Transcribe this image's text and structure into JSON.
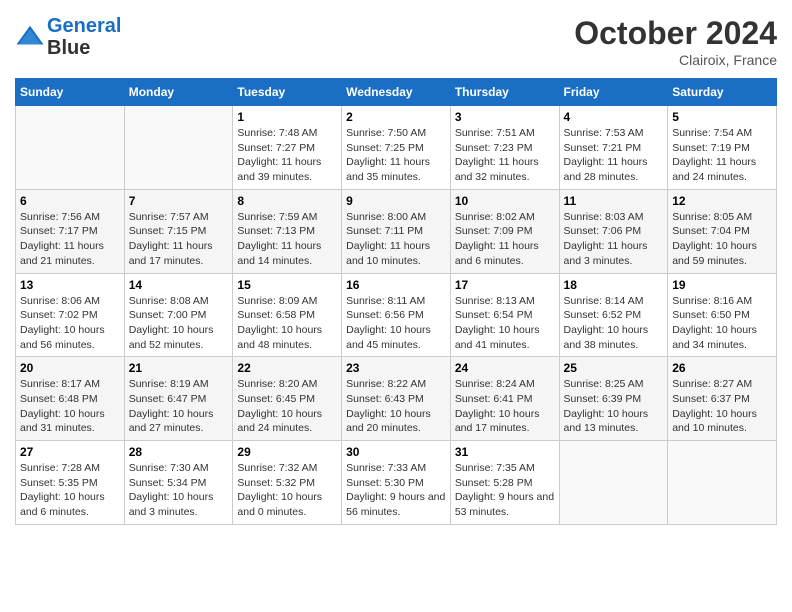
{
  "header": {
    "logo_line1": "General",
    "logo_line2": "Blue",
    "month": "October 2024",
    "location": "Clairoix, France"
  },
  "days_of_week": [
    "Sunday",
    "Monday",
    "Tuesday",
    "Wednesday",
    "Thursday",
    "Friday",
    "Saturday"
  ],
  "weeks": [
    [
      {
        "day": "",
        "info": ""
      },
      {
        "day": "",
        "info": ""
      },
      {
        "day": "1",
        "info": "Sunrise: 7:48 AM\nSunset: 7:27 PM\nDaylight: 11 hours and 39 minutes."
      },
      {
        "day": "2",
        "info": "Sunrise: 7:50 AM\nSunset: 7:25 PM\nDaylight: 11 hours and 35 minutes."
      },
      {
        "day": "3",
        "info": "Sunrise: 7:51 AM\nSunset: 7:23 PM\nDaylight: 11 hours and 32 minutes."
      },
      {
        "day": "4",
        "info": "Sunrise: 7:53 AM\nSunset: 7:21 PM\nDaylight: 11 hours and 28 minutes."
      },
      {
        "day": "5",
        "info": "Sunrise: 7:54 AM\nSunset: 7:19 PM\nDaylight: 11 hours and 24 minutes."
      }
    ],
    [
      {
        "day": "6",
        "info": "Sunrise: 7:56 AM\nSunset: 7:17 PM\nDaylight: 11 hours and 21 minutes."
      },
      {
        "day": "7",
        "info": "Sunrise: 7:57 AM\nSunset: 7:15 PM\nDaylight: 11 hours and 17 minutes."
      },
      {
        "day": "8",
        "info": "Sunrise: 7:59 AM\nSunset: 7:13 PM\nDaylight: 11 hours and 14 minutes."
      },
      {
        "day": "9",
        "info": "Sunrise: 8:00 AM\nSunset: 7:11 PM\nDaylight: 11 hours and 10 minutes."
      },
      {
        "day": "10",
        "info": "Sunrise: 8:02 AM\nSunset: 7:09 PM\nDaylight: 11 hours and 6 minutes."
      },
      {
        "day": "11",
        "info": "Sunrise: 8:03 AM\nSunset: 7:06 PM\nDaylight: 11 hours and 3 minutes."
      },
      {
        "day": "12",
        "info": "Sunrise: 8:05 AM\nSunset: 7:04 PM\nDaylight: 10 hours and 59 minutes."
      }
    ],
    [
      {
        "day": "13",
        "info": "Sunrise: 8:06 AM\nSunset: 7:02 PM\nDaylight: 10 hours and 56 minutes."
      },
      {
        "day": "14",
        "info": "Sunrise: 8:08 AM\nSunset: 7:00 PM\nDaylight: 10 hours and 52 minutes."
      },
      {
        "day": "15",
        "info": "Sunrise: 8:09 AM\nSunset: 6:58 PM\nDaylight: 10 hours and 48 minutes."
      },
      {
        "day": "16",
        "info": "Sunrise: 8:11 AM\nSunset: 6:56 PM\nDaylight: 10 hours and 45 minutes."
      },
      {
        "day": "17",
        "info": "Sunrise: 8:13 AM\nSunset: 6:54 PM\nDaylight: 10 hours and 41 minutes."
      },
      {
        "day": "18",
        "info": "Sunrise: 8:14 AM\nSunset: 6:52 PM\nDaylight: 10 hours and 38 minutes."
      },
      {
        "day": "19",
        "info": "Sunrise: 8:16 AM\nSunset: 6:50 PM\nDaylight: 10 hours and 34 minutes."
      }
    ],
    [
      {
        "day": "20",
        "info": "Sunrise: 8:17 AM\nSunset: 6:48 PM\nDaylight: 10 hours and 31 minutes."
      },
      {
        "day": "21",
        "info": "Sunrise: 8:19 AM\nSunset: 6:47 PM\nDaylight: 10 hours and 27 minutes."
      },
      {
        "day": "22",
        "info": "Sunrise: 8:20 AM\nSunset: 6:45 PM\nDaylight: 10 hours and 24 minutes."
      },
      {
        "day": "23",
        "info": "Sunrise: 8:22 AM\nSunset: 6:43 PM\nDaylight: 10 hours and 20 minutes."
      },
      {
        "day": "24",
        "info": "Sunrise: 8:24 AM\nSunset: 6:41 PM\nDaylight: 10 hours and 17 minutes."
      },
      {
        "day": "25",
        "info": "Sunrise: 8:25 AM\nSunset: 6:39 PM\nDaylight: 10 hours and 13 minutes."
      },
      {
        "day": "26",
        "info": "Sunrise: 8:27 AM\nSunset: 6:37 PM\nDaylight: 10 hours and 10 minutes."
      }
    ],
    [
      {
        "day": "27",
        "info": "Sunrise: 7:28 AM\nSunset: 5:35 PM\nDaylight: 10 hours and 6 minutes."
      },
      {
        "day": "28",
        "info": "Sunrise: 7:30 AM\nSunset: 5:34 PM\nDaylight: 10 hours and 3 minutes."
      },
      {
        "day": "29",
        "info": "Sunrise: 7:32 AM\nSunset: 5:32 PM\nDaylight: 10 hours and 0 minutes."
      },
      {
        "day": "30",
        "info": "Sunrise: 7:33 AM\nSunset: 5:30 PM\nDaylight: 9 hours and 56 minutes."
      },
      {
        "day": "31",
        "info": "Sunrise: 7:35 AM\nSunset: 5:28 PM\nDaylight: 9 hours and 53 minutes."
      },
      {
        "day": "",
        "info": ""
      },
      {
        "day": "",
        "info": ""
      }
    ]
  ]
}
